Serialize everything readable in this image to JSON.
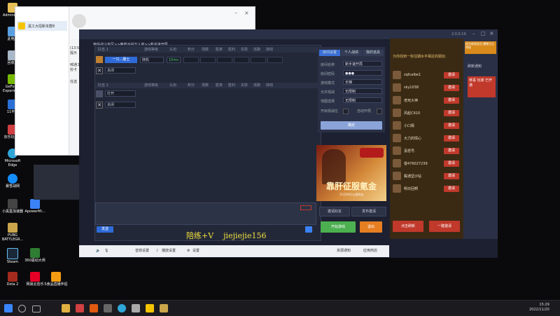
{
  "desktop": {
    "icons": [
      {
        "label": "Administr..."
      },
      {
        "label": "此电脑"
      },
      {
        "label": "回收站"
      },
      {
        "label": "GeForce Experience"
      },
      {
        "label": "11平台"
      },
      {
        "label": "京乐玩游戏"
      },
      {
        "label": "Microsoft Edge"
      },
      {
        "label": "暴雪战网"
      },
      {
        "label": "小黑盒加速器"
      },
      {
        "label": "ApowerMi..."
      },
      {
        "label": "PUBG BATTLEGR..."
      },
      {
        "label": "Steam"
      },
      {
        "label": "Dota 2"
      },
      {
        "label": "网易云音乐"
      },
      {
        "label": "360驱动大师"
      },
      {
        "label": "S食品直播伴侣"
      }
    ]
  },
  "qq_window": {
    "contact": "黑工大招新本群8",
    "chat_lines": [
      "(13:56) 提示",
      "喊通工站份卡",
      "任选"
    ]
  },
  "lobby": {
    "title_version": "2.0.0.19",
    "breadcrumb": "电信战斗专区>>魔兽对战万人房>>新手速开局",
    "team1_label": "队伍 1",
    "team2_label": "队伍 2",
    "columns": [
      "游戏等级",
      "头衔",
      "积分",
      "场数",
      "胜率",
      "胜利",
      "失败",
      "逃跑",
      "掉线"
    ],
    "player_name": "一只...服士",
    "player_race": "随机",
    "ping": "15ms",
    "slot_open": "打开",
    "slot_closed": "关闭",
    "chat_send": "发送"
  },
  "settings": {
    "tabs": [
      "房间设置",
      "个人战绩",
      "我的道具"
    ],
    "rows": [
      {
        "label": "房间名称",
        "value": "新手速开局"
      },
      {
        "label": "房间密码",
        "value": "●●●"
      },
      {
        "label": "游戏模式",
        "value": "天梯"
      },
      {
        "label": "允许观战",
        "value": "无限制"
      },
      {
        "label": "地图选择",
        "value": "无限制"
      }
    ],
    "check1": "开启观战位",
    "check2": "自动开局",
    "confirm": "确定"
  },
  "ad": {
    "headline": "靠肝征服氪金",
    "sub": "11月20日公测开启"
  },
  "actions": {
    "invite_friends": "邀请好友",
    "publish": "发布邀请",
    "start": "开始游戏",
    "quit": "退出"
  },
  "friends": {
    "header": "为你找到一些往期水平相近的朋友:",
    "invite_label": "邀请",
    "list": [
      "zqfcalbe1",
      "sky1038",
      "老死大神",
      "风起C910",
      "小口殿",
      "大力的情心",
      "喜怒号.",
      "菩476027239",
      "鬓通坚沙钻",
      "明日回啊"
    ],
    "refresh": "点击刷新",
    "invite_all": "一键邀请"
  },
  "side_panel": {
    "promo": "成为新锐会员 魔兽日元特权",
    "refresh": "刷新通知",
    "tip": "恭喜 玩家 已开通"
  },
  "bottom": {
    "items": [
      "音效设置",
      "播放设置",
      "设置"
    ],
    "right_items": [
      "资源通知",
      "应用商店"
    ]
  },
  "overlay_text": "陪练+V    jiejiejie156",
  "taskbar": {
    "time": "15:29",
    "date": "2022/11/20"
  }
}
